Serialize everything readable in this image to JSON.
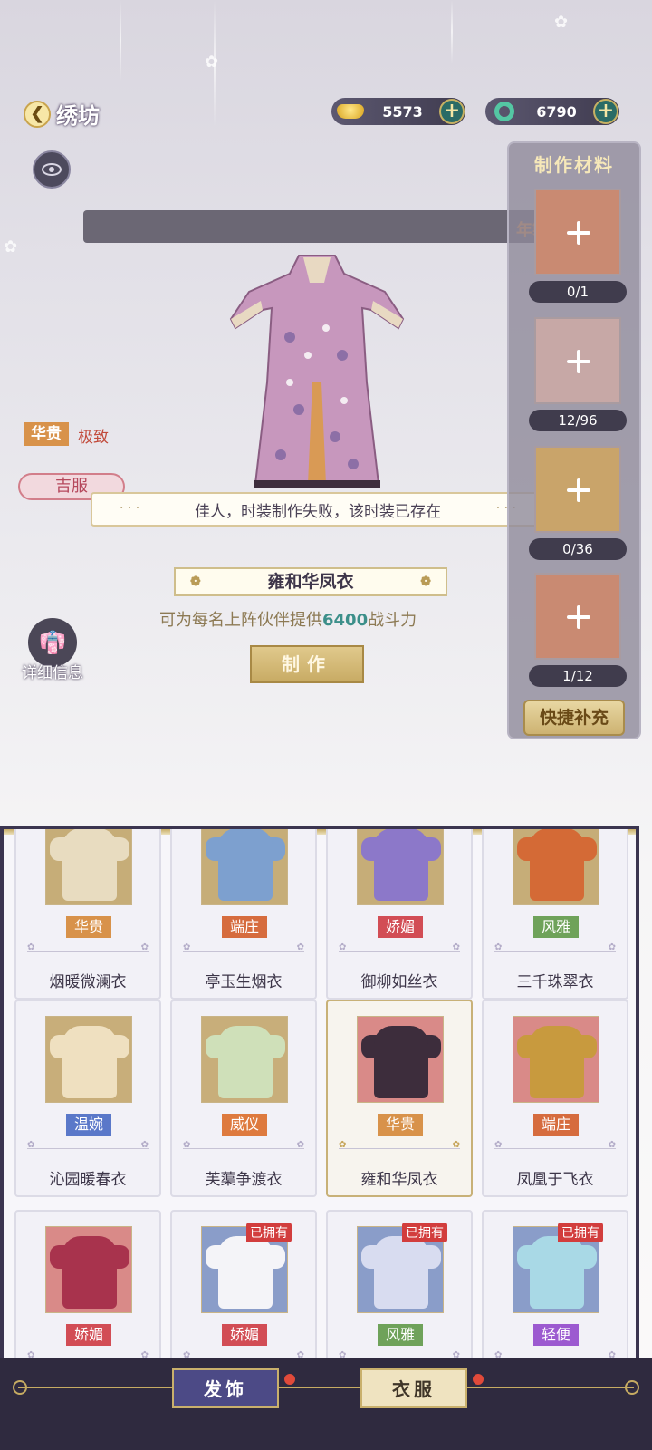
{
  "header": {
    "title": "绣坊"
  },
  "currencies": [
    {
      "icon": "gold-ingot-icon",
      "value": "5573"
    },
    {
      "icon": "jade-ring-icon",
      "value": "6790"
    }
  ],
  "banner": {
    "text": "年製"
  },
  "item": {
    "rarity": "华贵",
    "rarity_desc": "极致",
    "type": "吉服",
    "name": "雍和华凤衣",
    "power_prefix": "可为每名上阵伙伴提供",
    "power_value": "6400",
    "power_suffix": "战斗力",
    "make_label": "制作",
    "detail_label": "详细信息"
  },
  "toast": {
    "text": "佳人，时装制作失败，该时装已存在"
  },
  "materials": {
    "title": "制作材料",
    "slots": [
      {
        "count": "0/1",
        "color": "#c98a72"
      },
      {
        "count": "12/96",
        "color": "#c7a8a6"
      },
      {
        "count": "0/36",
        "color": "#c9a46a"
      },
      {
        "count": "1/12",
        "color": "#c98a72"
      }
    ],
    "refill_label": "快捷补充"
  },
  "cards": [
    {
      "badge": "华贵",
      "badge_color": "#d8924a",
      "name": "烟暖微澜衣",
      "thumb_bg": "#c6ad78",
      "robe": "#e8dcc0",
      "owned": ""
    },
    {
      "badge": "端庄",
      "badge_color": "#d66c3e",
      "name": "亭玉生烟衣",
      "thumb_bg": "#c6ad78",
      "robe": "#7da0cf",
      "owned": ""
    },
    {
      "badge": "娇媚",
      "badge_color": "#d24d55",
      "name": "御柳如丝衣",
      "thumb_bg": "#c6ad78",
      "robe": "#8c78c9",
      "owned": ""
    },
    {
      "badge": "风雅",
      "badge_color": "#6fa25a",
      "name": "三千珠翠衣",
      "thumb_bg": "#c6ad78",
      "robe": "#d46a36",
      "owned": ""
    },
    {
      "badge": "温婉",
      "badge_color": "#5a78c9",
      "name": "沁园暖春衣",
      "thumb_bg": "#c8ae7a",
      "robe": "#efe0c0",
      "owned": ""
    },
    {
      "badge": "威仪",
      "badge_color": "#de7a3e",
      "name": "芙蕖争渡衣",
      "thumb_bg": "#c8ae7a",
      "robe": "#cfe0b9",
      "owned": ""
    },
    {
      "badge": "华贵",
      "badge_color": "#d8924a",
      "name": "雍和华凤衣",
      "thumb_bg": "#d98a88",
      "robe": "#3d2d3c",
      "owned": ""
    },
    {
      "badge": "端庄",
      "badge_color": "#d66c3e",
      "name": "凤凰于飞衣",
      "thumb_bg": "#d98a88",
      "robe": "#c89a3e",
      "owned": ""
    },
    {
      "badge": "娇媚",
      "badge_color": "#d24d55",
      "name": "",
      "thumb_bg": "#d98a88",
      "robe": "#a8334d",
      "owned": ""
    },
    {
      "badge": "娇媚",
      "badge_color": "#d24d55",
      "name": "",
      "thumb_bg": "#8a9dc9",
      "robe": "#f4f4f8",
      "owned": "已拥有"
    },
    {
      "badge": "风雅",
      "badge_color": "#6fa25a",
      "name": "",
      "thumb_bg": "#8a9dc9",
      "robe": "#d8dcf0",
      "owned": "已拥有"
    },
    {
      "badge": "轻便",
      "badge_color": "#9c5ad0",
      "name": "",
      "thumb_bg": "#8a9dc9",
      "robe": "#a9d9e6",
      "owned": "已拥有"
    }
  ],
  "selected_card": 6,
  "nav": {
    "hair_label": "发饰",
    "clothes_label": "衣服"
  }
}
